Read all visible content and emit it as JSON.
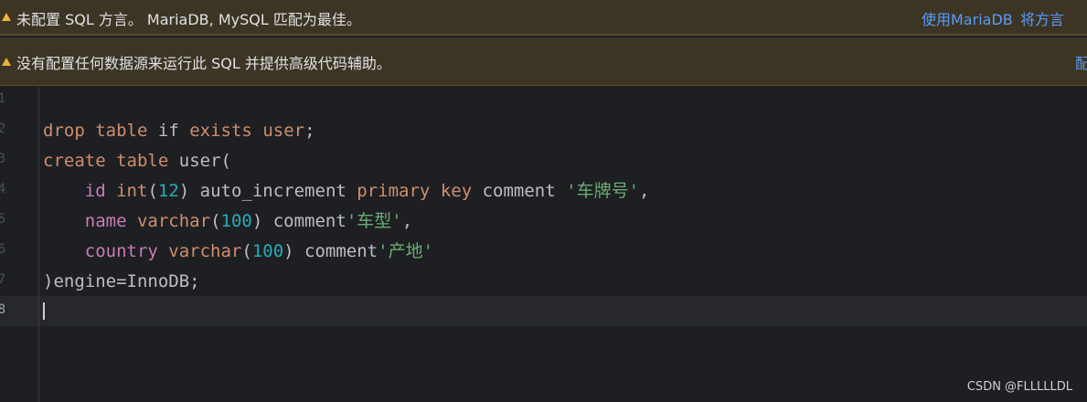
{
  "banners": {
    "dialect": {
      "text": "未配置 SQL 方言。 MariaDB, MySQL 匹配为最佳。",
      "link_mariadb": "使用MariaDB",
      "link_set_dialect": "将方言"
    },
    "datasource": {
      "text": "没有配置任何数据源来运行此 SQL 并提供高级代码辅助。",
      "link_config": "配"
    }
  },
  "editor": {
    "line_numbers": [
      "1",
      "2",
      "3",
      "4",
      "5",
      "6",
      "7",
      "8"
    ],
    "current_line": "8",
    "code": {
      "l2": {
        "kw_drop": "drop",
        "kw_table": "table",
        "kw_if": "if",
        "kw_exists": "exists",
        "name": "user",
        "end": ";"
      },
      "l3": {
        "kw_create": "create",
        "kw_table": "table",
        "name_open": "user("
      },
      "l4": {
        "col": "id",
        "type": "int",
        "num": "12",
        "auto": "auto_increment",
        "kw_primary": "primary",
        "kw_key": "key",
        "comment": "comment",
        "str": "'车牌号'",
        "end": ","
      },
      "l5": {
        "col": "name",
        "type": "varchar",
        "num": "100",
        "comment": "comment",
        "str": "'车型'",
        "end": ","
      },
      "l6": {
        "col": "country",
        "type": "varchar",
        "num": "100",
        "comment": "comment",
        "str": "'产地'"
      },
      "l7": {
        "text": ")engine=InnoDB;"
      }
    }
  },
  "watermark": "CSDN @FLLLLLDL",
  "colors": {
    "banner_bg": "#3d3524",
    "editor_bg": "#1e1f22",
    "keyword": "#cf8e6d",
    "field": "#c77dbb",
    "number": "#2aacb8",
    "string": "#6aab73",
    "link": "#5a9bf7"
  }
}
